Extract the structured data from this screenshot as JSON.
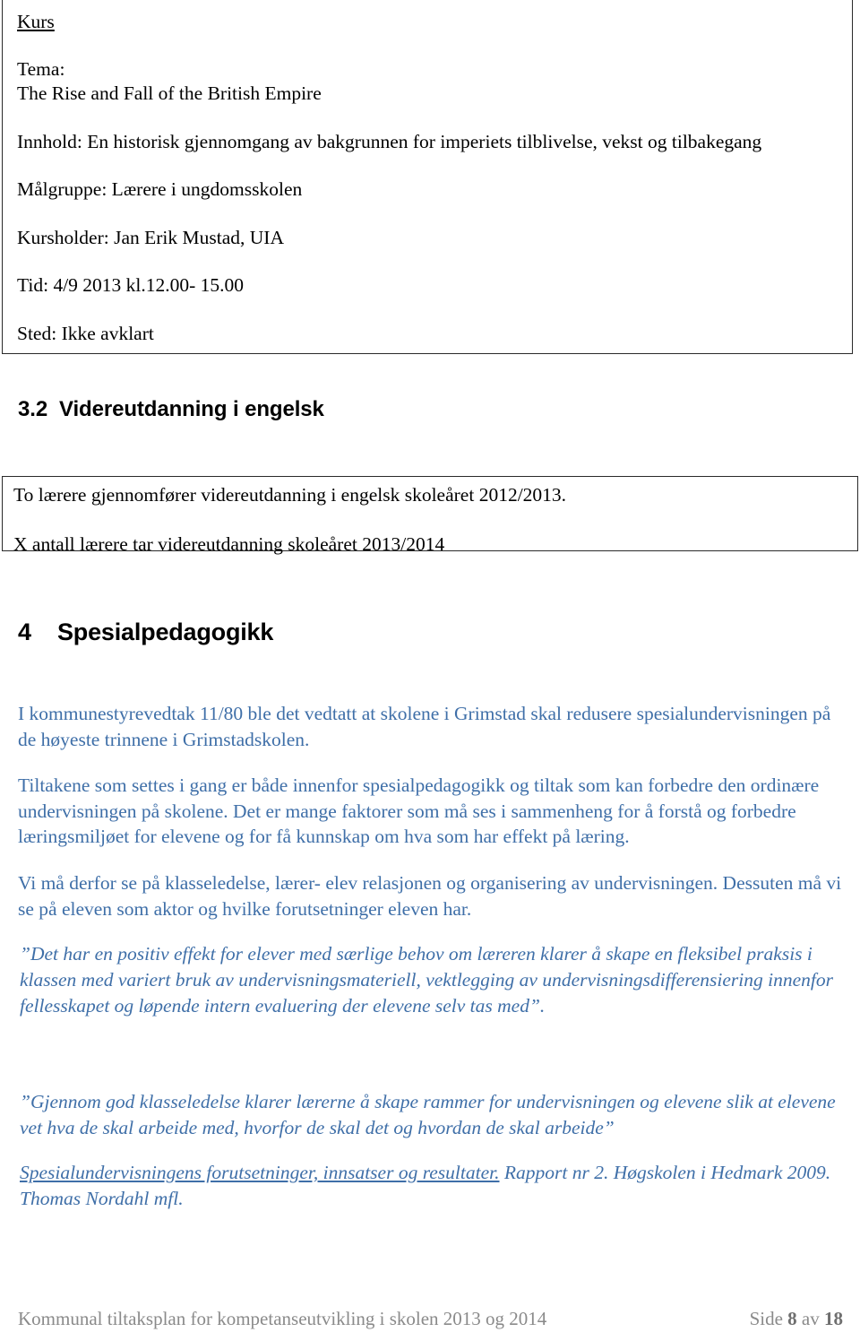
{
  "course_box": {
    "title": "Kurs",
    "lines": [
      "Tema:",
      "The Rise and Fall of the British Empire",
      "Innhold: En historisk gjennomgang av bakgrunnen for imperiets tilblivelse, vekst og tilbakegang",
      "Målgruppe: Lærere i ungdomsskolen",
      "Kursholder: Jan Erik Mustad, UIA",
      "Tid: 4/9 2013 kl.12.00- 15.00",
      "Sted: Ikke avklart"
    ]
  },
  "section_3_2": {
    "number": "3.2",
    "title": "Videreutdanning i engelsk",
    "box_lines": [
      "To lærere gjennomfører videreutdanning i engelsk skoleåret 2012/2013.",
      "X antall lærere tar videreutdanning skoleåret 2013/2014"
    ]
  },
  "section_4": {
    "number": "4",
    "title": "Spesialpedagogikk",
    "paragraph_1": "I kommunestyrevedtak 11/80 ble det vedtatt at skolene i Grimstad skal redusere spesialundervisningen på de høyeste trinnene i Grimstadskolen.",
    "paragraph_2": "Tiltakene som settes i gang er både innenfor spesialpedagogikk og tiltak som kan forbedre den ordinære undervisningen på skolene. Det er mange faktorer som må ses i sammenheng for å forstå og forbedre læringsmiljøet for elevene og for få kunnskap om hva som har effekt på læring.",
    "paragraph_3": "Vi må derfor se på klasseledelse, lærer- elev relasjonen og organisering av undervisningen. Dessuten må vi se på eleven som aktor og hvilke forutsetninger eleven har.",
    "quote_1": "”Det har en positiv effekt for elever med særlige behov om læreren klarer å skape en fleksibel praksis i klassen med variert bruk av undervisningsmateriell, vektlegging av undervisningsdifferensiering innenfor fellesskapet og løpende intern evaluering der elevene selv tas med”.",
    "quote_2": "”Gjennom god klasseledelse klarer lærerne å skape rammer for undervisningen og elevene slik at elevene vet hva de skal arbeide med, hvorfor de skal det og hvordan de skal arbeide”",
    "citation_underlined": "Spesialundervisningens forutsetninger, innsatser og resultater.",
    "citation_rest": " Rapport nr 2. Høgskolen i Hedmark 2009. Thomas Nordahl mfl."
  },
  "footer": {
    "left": "Kommunal tiltaksplan for kompetanseutvikling i skolen 2013 og 2014",
    "page_label": "Side",
    "page_current": "8",
    "page_of": "av",
    "page_total": "18"
  },
  "colors": {
    "body_blue": "#3f6fa8",
    "footer_grey": "#8a8a8a",
    "border": "#2a2a2a",
    "heading_black": "#000000"
  }
}
